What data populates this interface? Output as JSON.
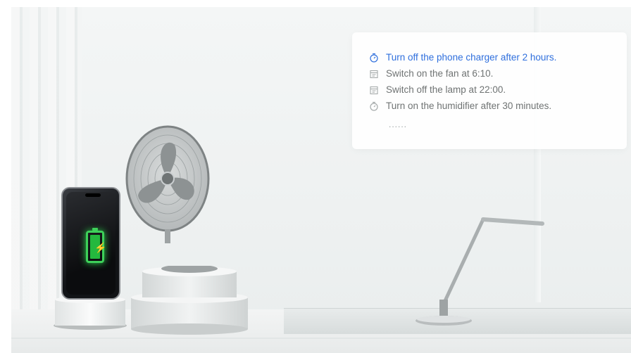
{
  "panel": {
    "tasks": [
      {
        "label": "Turn off the phone charger after 2 hours.",
        "icon": "timer-icon",
        "active": true
      },
      {
        "label": "Switch on the fan at 6:10.",
        "icon": "calendar-icon",
        "active": false
      },
      {
        "label": "Switch off the lamp at 22:00.",
        "icon": "calendar-icon",
        "active": false
      },
      {
        "label": "Turn on the humidifier after 30 minutes.",
        "icon": "timer-icon",
        "active": false
      }
    ],
    "more": "......"
  },
  "colors": {
    "active_text": "#2f6fdd",
    "inactive_text": "#6f7373",
    "battery_green": "#3ed15a"
  }
}
